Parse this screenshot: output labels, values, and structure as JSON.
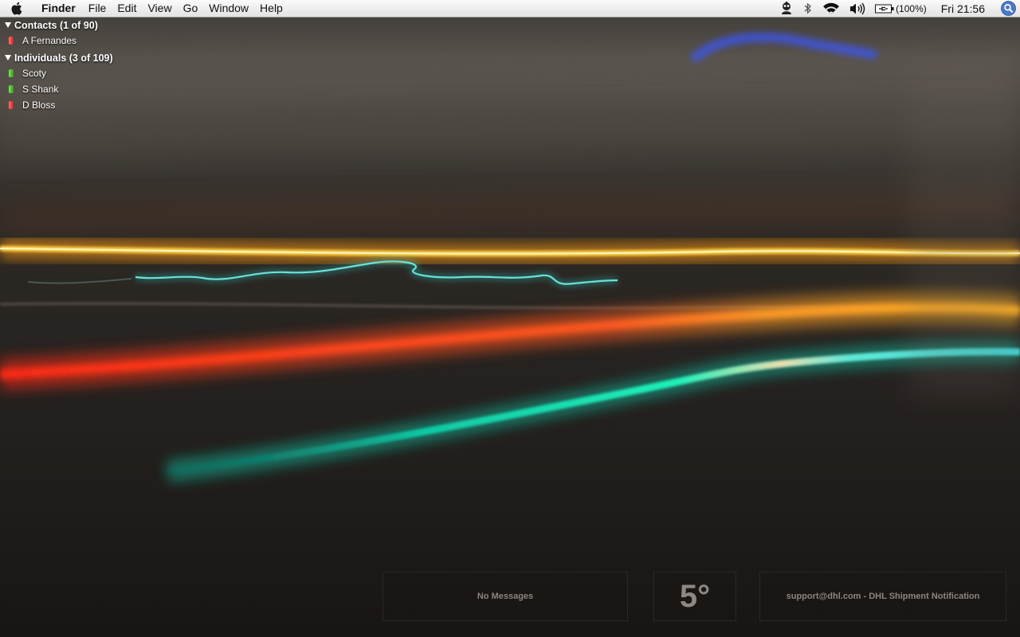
{
  "menubar": {
    "app_name": "Finder",
    "menus": [
      "File",
      "Edit",
      "View",
      "Go",
      "Window",
      "Help"
    ],
    "battery": "(100%)",
    "clock": "Fri 21:56",
    "status_icons": [
      "user-icon",
      "bluetooth-icon",
      "wifi-icon",
      "volume-icon",
      "battery-icon",
      "spotlight-icon"
    ]
  },
  "buddy_list": {
    "groups": [
      {
        "header": "Contacts (1 of 90)",
        "buddies": [
          {
            "name": "A Fernandes",
            "status": "red"
          }
        ]
      },
      {
        "header": "Individuals (3 of 109)",
        "buddies": [
          {
            "name": "Scoty",
            "status": "green"
          },
          {
            "name": "S Shank",
            "status": "green"
          },
          {
            "name": "D Bloss",
            "status": "red"
          }
        ]
      }
    ]
  },
  "widgets": {
    "messages": "No Messages",
    "temperature": "5°",
    "mail": "support@dhl.com - DHL Shipment Notification"
  },
  "colors": {
    "status_red": "#d11c1c",
    "status_green": "#2f9c12",
    "trail_yellow": "#ffd23a",
    "trail_red": "#ff4a1e",
    "trail_teal": "#1fe8c0"
  }
}
